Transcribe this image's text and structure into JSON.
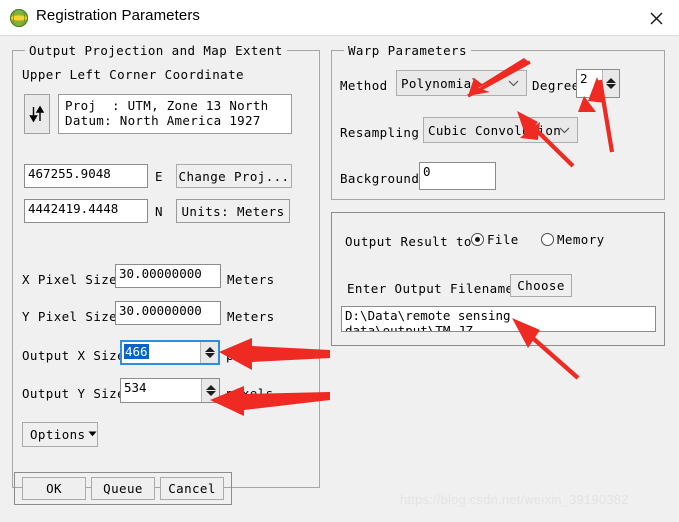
{
  "window": {
    "title": "Registration Parameters",
    "icon": "globe-icon",
    "close_label": "close-icon"
  },
  "left_panel": {
    "group_title": "Output Projection and Map Extent",
    "corner_label": "Upper Left Corner Coordinate",
    "swap_icon": "up-down-arrows-icon",
    "projection_info": "Proj  : UTM, Zone 13 North\nDatum: North America 1927",
    "easting_value": "467255.9048",
    "easting_unit": "E",
    "northing_value": "4442419.4448",
    "northing_unit": "N",
    "change_proj_label": "Change Proj...",
    "units_label": "Units: Meters",
    "x_pixel_size_label": "X Pixel Size",
    "x_pixel_size_value": "30.00000000",
    "x_pixel_size_unit": "Meters",
    "y_pixel_size_label": "Y Pixel Size",
    "y_pixel_size_value": "30.00000000",
    "y_pixel_size_unit": "Meters",
    "output_x_label": "Output X Size",
    "output_x_value": "466",
    "output_x_unit": "pixels",
    "output_y_label": "Output Y Size",
    "output_y_value": "534",
    "output_y_unit": "pixels",
    "options_label": "Options",
    "options_carat": "triangle-down-icon"
  },
  "warp_panel": {
    "group_title": "Warp Parameters",
    "method_label": "Method",
    "method_value": "Polynomial",
    "degree_label": "Degree",
    "degree_value": "2",
    "resampling_label": "Resampling",
    "resampling_value": "Cubic Convolution",
    "background_label": "Background",
    "background_value": "0"
  },
  "output_panel": {
    "output_result_label": "Output Result to",
    "file_option": "File",
    "memory_option": "Memory",
    "selected_output": "File",
    "filename_label": "Enter Output Filename",
    "choose_label": "Choose",
    "filename_value": "D:\\Data\\remote sensing data\\output\\TM_JZ."
  },
  "footer": {
    "ok_label": "OK",
    "queue_label": "Queue",
    "cancel_label": "Cancel"
  },
  "watermark": {
    "text": "https://blog.csdn.net/weixin_39190382"
  },
  "colors": {
    "accent": "#2a8fe0",
    "selection": "#0a64c8",
    "arrow": "#ee2a23",
    "window_bg": "#f0f0f0"
  }
}
